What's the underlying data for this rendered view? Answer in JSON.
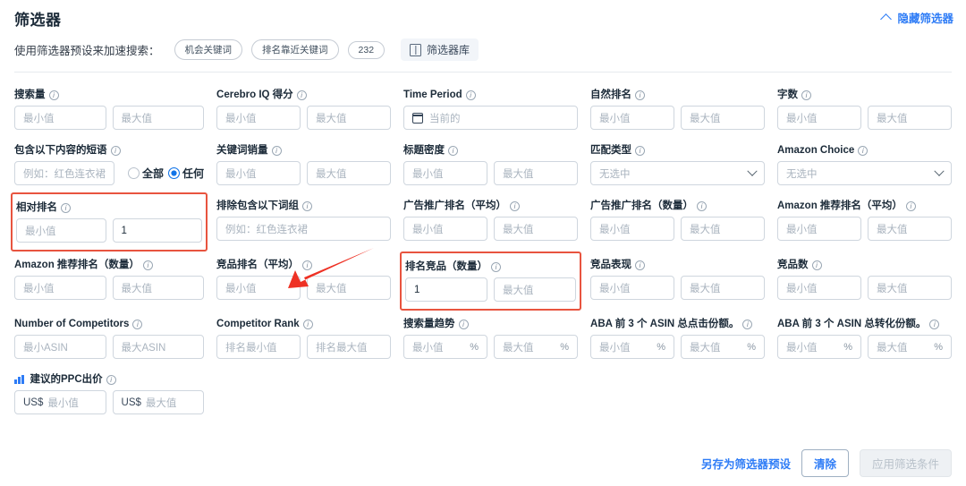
{
  "header": {
    "title": "筛选器",
    "hide_filters_label": "隐藏筛选器",
    "presets_label": "使用筛选器预设来加速搜索：",
    "presets": [
      {
        "label": "机会关键词"
      },
      {
        "label": "排名靠近关键词"
      },
      {
        "label": "232"
      }
    ],
    "library_button": "筛选器库"
  },
  "common": {
    "min_placeholder": "最小值",
    "max_placeholder": "最大值",
    "none_selected": "无选中",
    "percent": "%",
    "usd": "US$",
    "phrase_placeholder": "例如：红色连衣裙"
  },
  "fields": [
    {
      "label": "搜索量",
      "min": "最小值",
      "max": "最大值"
    },
    {
      "label": "Cerebro IQ 得分",
      "min": "最小值",
      "max": "最大值"
    },
    {
      "label": "Time Period",
      "value": "当前的"
    },
    {
      "label": "自然排名",
      "min": "最小值",
      "max": "最大值"
    },
    {
      "label": "字数",
      "min": "最小值",
      "max": "最大值"
    },
    {
      "label": "包含以下内容的短语",
      "phrase": "例如：红色连衣裙",
      "radio_all": "全部",
      "radio_any": "任何",
      "selected": "任何"
    },
    {
      "label": "关键词销量",
      "min": "最小值",
      "max": "最大值"
    },
    {
      "label": "标题密度",
      "min": "最小值",
      "max": "最大值"
    },
    {
      "label": "匹配类型",
      "select": "无选中"
    },
    {
      "label": "Amazon Choice",
      "select": "无选中"
    },
    {
      "label": "相对排名",
      "min": "最小值",
      "max": "1"
    },
    {
      "label": "排除包含以下词组",
      "phrase": "例如：红色连衣裙"
    },
    {
      "label": "广告推广排名（平均）",
      "min": "最小值",
      "max": "最大值"
    },
    {
      "label": "广告推广排名（数量）",
      "min": "最小值",
      "max": "最大值"
    },
    {
      "label": "Amazon 推荐排名（平均）",
      "min": "最小值",
      "max": "最大值"
    },
    {
      "label": "Amazon 推荐排名（数量）",
      "min": "最小值",
      "max": "最大值"
    },
    {
      "label": "竞品排名（平均）",
      "min": "最小值",
      "max": "最大值"
    },
    {
      "label": "排名竞品（数量）",
      "min": "1",
      "max": "最大值"
    },
    {
      "label": "竞品表现",
      "min": "最小值",
      "max": "最大值"
    },
    {
      "label": "竞品数",
      "min": "最小值",
      "max": "最大值"
    },
    {
      "label": "Number of Competitors",
      "min": "最小ASIN",
      "max": "最大ASIN"
    },
    {
      "label": "Competitor Rank",
      "min": "排名最小值",
      "max": "排名最大值"
    },
    {
      "label": "搜索量趋势",
      "min": "最小值",
      "max": "最大值",
      "suffix": "%"
    },
    {
      "label": "ABA 前 3 个 ASIN 总点击份额。",
      "min": "最小值",
      "max": "最大值",
      "suffix": "%"
    },
    {
      "label": "ABA 前 3 个 ASIN 总转化份额。",
      "min": "最小值",
      "max": "最大值",
      "suffix": "%"
    },
    {
      "label": "建议的PPC出价",
      "min": "最小值",
      "max": "最大值",
      "prefix": "US$"
    }
  ],
  "footer": {
    "save_preset": "另存为筛选器预设",
    "clear": "清除",
    "apply": "应用筛选条件"
  },
  "annotation": {
    "highlight_color": "#e8543f",
    "accent_color": "#2e7cf6"
  }
}
